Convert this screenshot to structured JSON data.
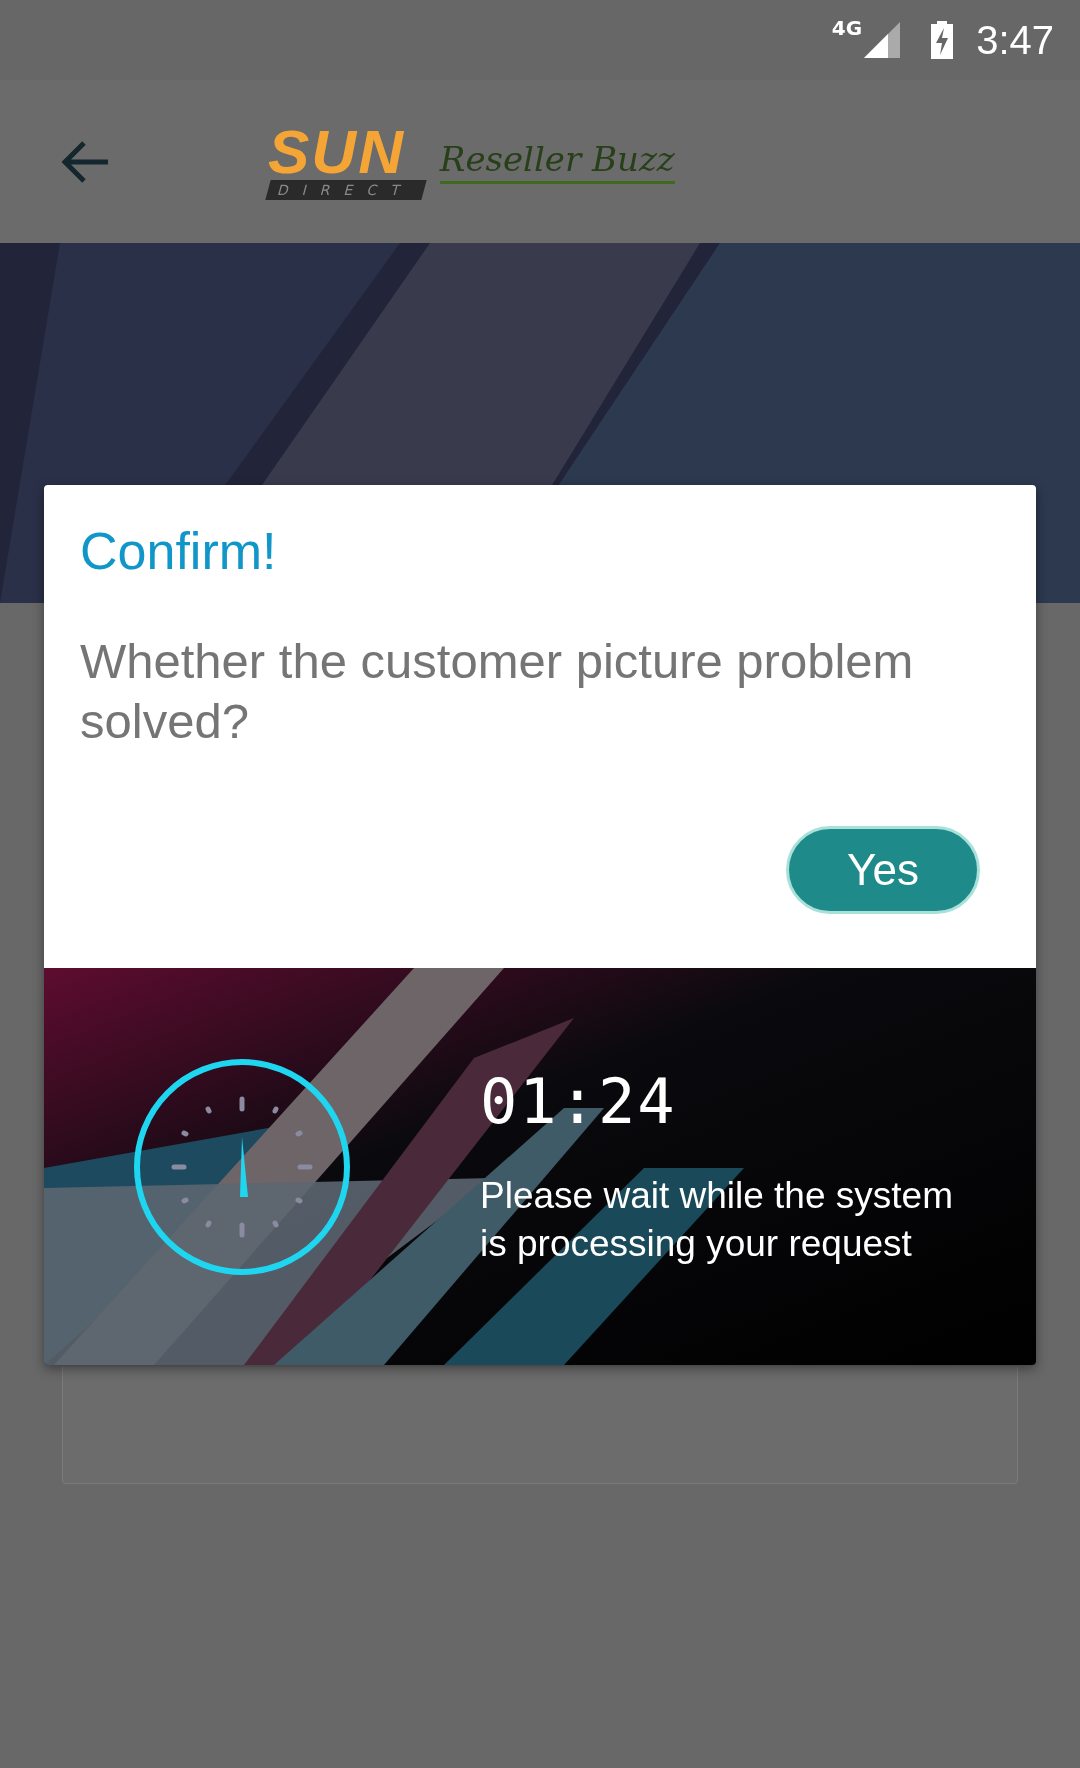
{
  "status_bar": {
    "network": "4G",
    "time": "3:47"
  },
  "header": {
    "logo_brand": "SUN",
    "logo_sub": "DIRECT",
    "logo_tagline": "Reseller Buzz"
  },
  "dialog": {
    "title": "Confirm!",
    "message": "Whether the customer picture problem solved?",
    "buttons": [
      "Yes"
    ],
    "timer": {
      "time": "01:24",
      "message": "Please wait while the system is processing your request"
    }
  }
}
